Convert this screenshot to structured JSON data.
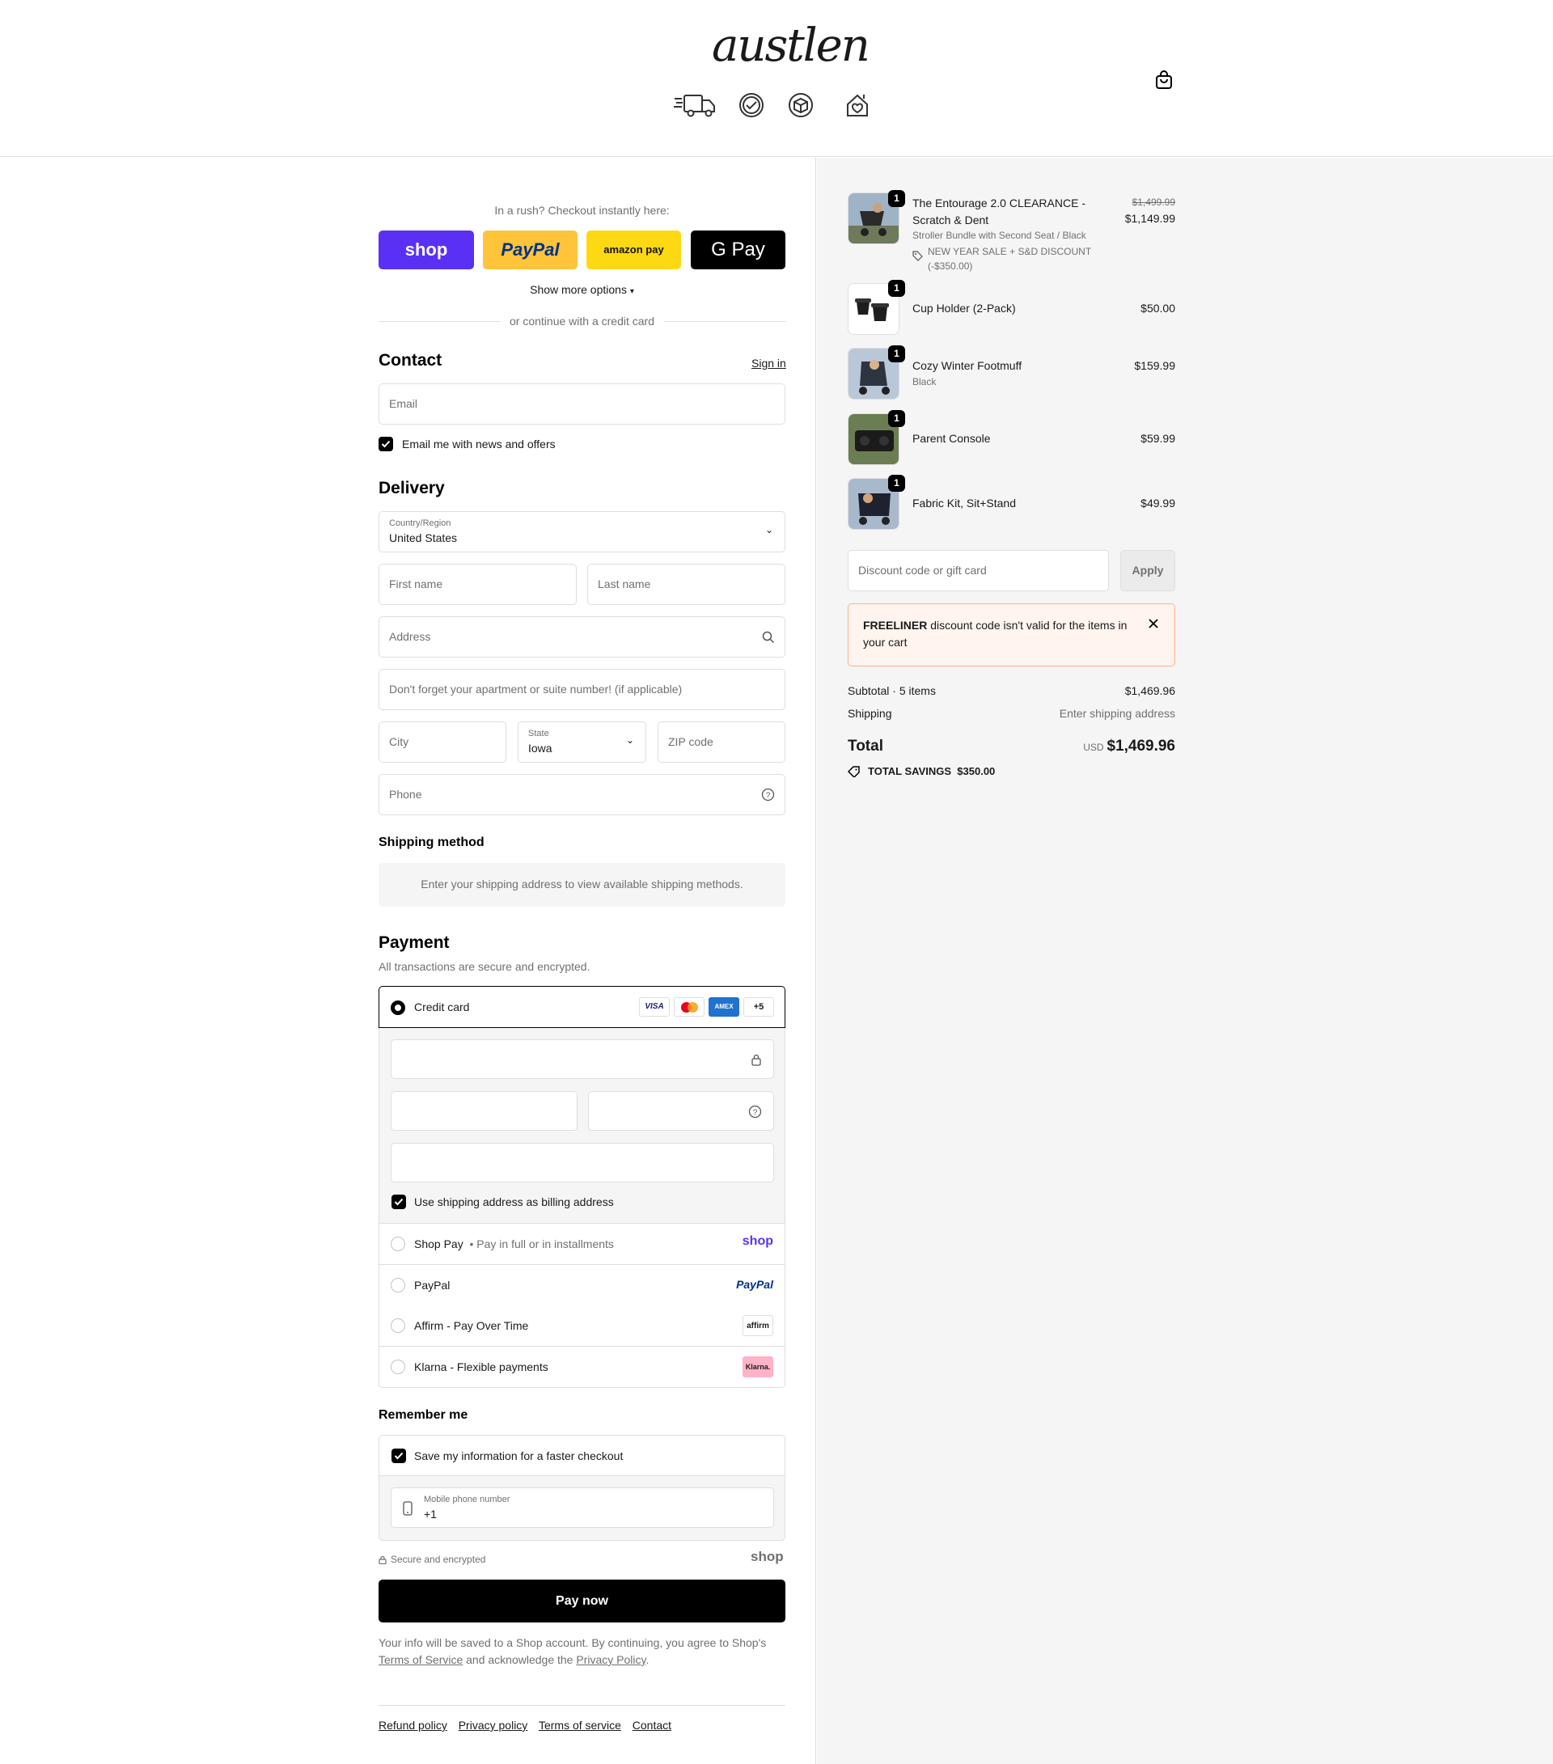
{
  "header": {
    "logo_text": "austlen",
    "trust_icons": [
      "fast-shipping-truck-icon",
      "verified-badge-icon",
      "package-box-icon",
      "home-heart-icon"
    ],
    "cart_icon": "shopping-bag-icon"
  },
  "express": {
    "prompt": "In a rush? Checkout instantly here:",
    "buttons": [
      {
        "label": "shop",
        "color": "#5a31f4",
        "text_color": "#ffffff"
      },
      {
        "label": "PayPal",
        "color": "#ffc439",
        "text_color": "#003087"
      },
      {
        "label": "amazon pay",
        "color": "#ffd814",
        "text_color": "#111111"
      },
      {
        "label": "G Pay",
        "color": "#000000",
        "text_color": "#ffffff"
      }
    ],
    "show_more": "Show more options",
    "divider": "or continue with a credit card"
  },
  "contact": {
    "title": "Contact",
    "sign_in": "Sign in",
    "email_placeholder": "Email",
    "newsletter": "Email me with news and offers",
    "newsletter_checked": true
  },
  "delivery": {
    "title": "Delivery",
    "country_label": "Country/Region",
    "country_value": "United States",
    "first_name": "First name",
    "last_name": "Last name",
    "address": "Address",
    "apartment": "Don't forget your apartment or suite number! (if applicable)",
    "city": "City",
    "state_label": "State",
    "state_value": "Iowa",
    "zip": "ZIP code",
    "phone": "Phone"
  },
  "shipping_method": {
    "title": "Shipping method",
    "message": "Enter your shipping address to view available shipping methods."
  },
  "payment": {
    "title": "Payment",
    "subtitle": "All transactions are secure and encrypted.",
    "credit_card_label": "Credit card",
    "card_brands": [
      "VISA",
      "mastercard",
      "AMEX"
    ],
    "more_brands": "+5",
    "billing_same": "Use shipping address as billing address",
    "options": [
      {
        "label": "Shop Pay",
        "sub": "Pay in full or in installments",
        "logo": "shop"
      },
      {
        "label": "PayPal",
        "sub": "",
        "logo": "PayPal"
      },
      {
        "label": "Affirm - Pay Over Time",
        "sub": "",
        "logo": "affirm"
      },
      {
        "label": "Klarna - Flexible payments",
        "sub": "",
        "logo": "Klarna."
      }
    ]
  },
  "remember": {
    "title": "Remember me",
    "save_label": "Save my information for a faster checkout",
    "mobile_label": "Mobile phone number",
    "mobile_value": "+1",
    "secure": "Secure and encrypted",
    "shop_logo": "shop"
  },
  "pay_now": "Pay now",
  "legal": {
    "text1": "Your info will be saved to a Shop account. By continuing, you agree to Shop's",
    "terms": "Terms of Service",
    "text2": "and acknowledge the",
    "privacy": "Privacy Policy",
    "text3": "."
  },
  "footer_links": [
    "Refund policy",
    "Privacy policy",
    "Terms of service",
    "Contact"
  ],
  "summary": {
    "items": [
      {
        "name": "The Entourage 2.0 CLEARANCE - Scratch & Dent",
        "variant": "Stroller Bundle with Second Seat / Black",
        "discount": "NEW YEAR SALE + S&D DISCOUNT",
        "discount_amount": "(-$350.00)",
        "original_price": "$1,499.99",
        "price": "$1,149.99",
        "qty": "1"
      },
      {
        "name": "Cup Holder (2-Pack)",
        "variant": "",
        "price": "$50.00",
        "qty": "1"
      },
      {
        "name": "Cozy Winter Footmuff",
        "variant": "Black",
        "price": "$159.99",
        "qty": "1"
      },
      {
        "name": "Parent Console",
        "variant": "",
        "price": "$59.99",
        "qty": "1"
      },
      {
        "name": "Fabric Kit, Sit+Stand",
        "variant": "",
        "price": "$49.99",
        "qty": "1"
      }
    ],
    "discount_placeholder": "Discount code or gift card",
    "apply": "Apply",
    "error_code": "FREELINER",
    "error_text": "discount code isn't valid for the items in your cart",
    "subtotal_label": "Subtotal · 5 items",
    "subtotal": "$1,469.96",
    "shipping_label": "Shipping",
    "shipping_value": "Enter shipping address",
    "total_label": "Total",
    "currency": "USD",
    "total": "$1,469.96",
    "savings_label": "TOTAL SAVINGS",
    "savings": "$350.00"
  }
}
